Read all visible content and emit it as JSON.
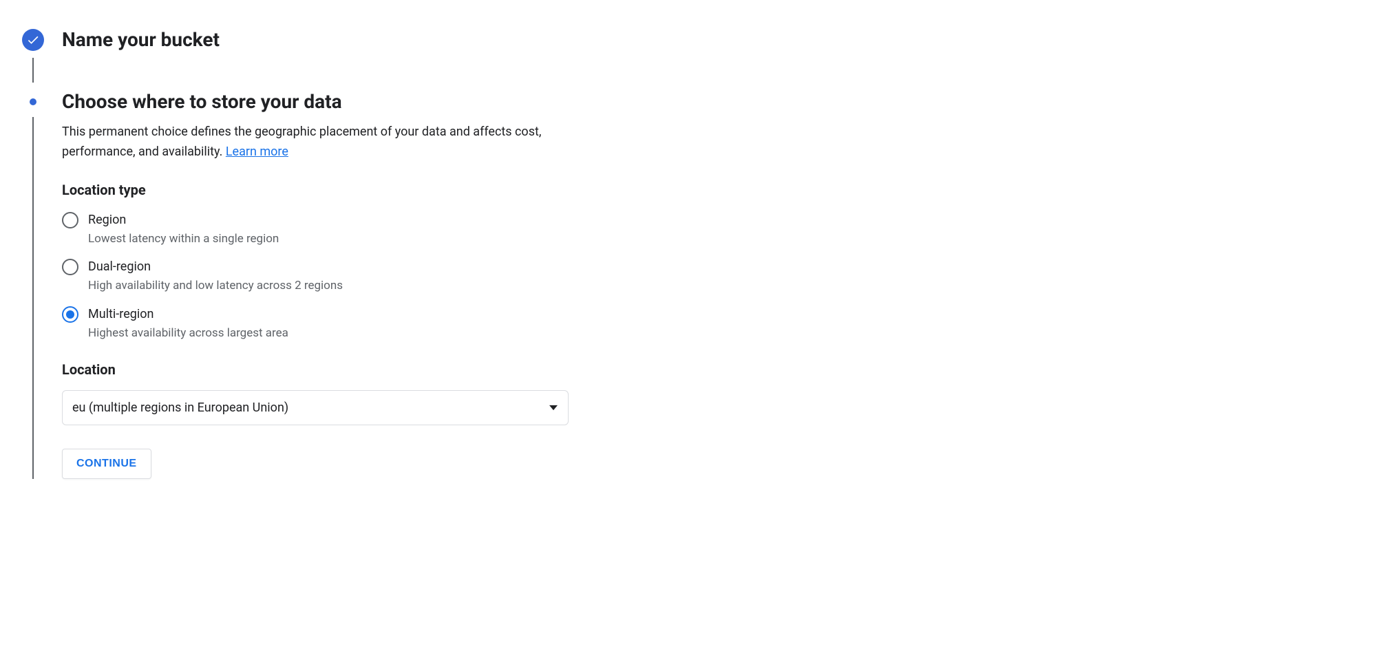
{
  "steps": {
    "name_bucket": {
      "title": "Name your bucket"
    },
    "choose_location": {
      "title": "Choose where to store your data",
      "description_prefix": "This permanent choice defines the geographic placement of your data and affects cost, performance, and availability. ",
      "learn_more": "Learn more"
    }
  },
  "location_type": {
    "heading": "Location type",
    "options": [
      {
        "label": "Region",
        "sublabel": "Lowest latency within a single region",
        "selected": false
      },
      {
        "label": "Dual-region",
        "sublabel": "High availability and low latency across 2 regions",
        "selected": false
      },
      {
        "label": "Multi-region",
        "sublabel": "Highest availability across largest area",
        "selected": true
      }
    ]
  },
  "location": {
    "heading": "Location",
    "selected_value": "eu (multiple regions in European Union)"
  },
  "continue_button": "CONTINUE"
}
